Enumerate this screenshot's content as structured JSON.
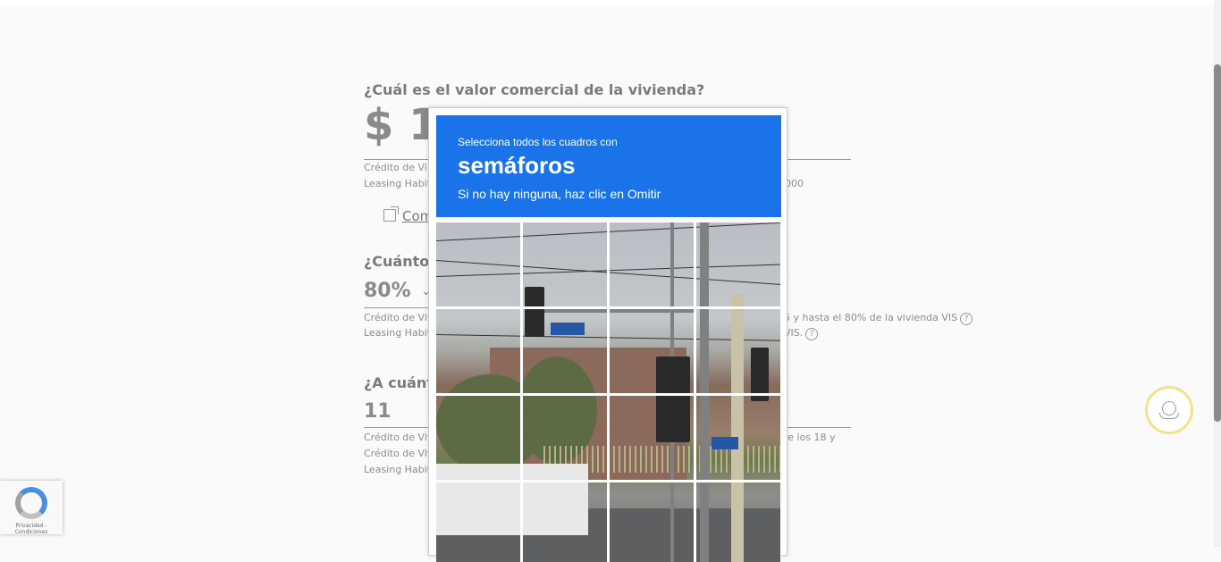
{
  "form": {
    "q1": {
      "title": "¿Cuál es el valor comercial de la vivienda?",
      "value": "$ 1",
      "hint1": "Crédito de Vi",
      "hint2": "Leasing Habit",
      "hint2_tail": "000",
      "link": "Com"
    },
    "q2": {
      "title": "¿Cuánto d",
      "value": "80%",
      "hint1": "Crédito de Viv",
      "hint1_tail": "5 y hasta el 80% de la vivienda VIS",
      "hint2": "Leasing Habit",
      "hint2_tail": "VIS.",
      "help": "?"
    },
    "q3": {
      "title": "¿A cuánto",
      "value": "11",
      "hint1": "Crédito de Viv",
      "hint1_tail": "re los 18 y",
      "hint2": "Crédito de Viv",
      "hint3": "Leasing Habit"
    }
  },
  "captcha": {
    "instruction": "Selecciona todos los cuadros con",
    "target": "semáforos",
    "skip_hint": "Si no hay ninguna, haz clic en Omitir",
    "grid_rows": 4,
    "grid_cols": 4
  },
  "recaptcha_badge": {
    "links": "Privacidad - Condiciones"
  },
  "colors": {
    "captcha_header": "#1a73e8",
    "chat_ring": "#f0e38a"
  }
}
